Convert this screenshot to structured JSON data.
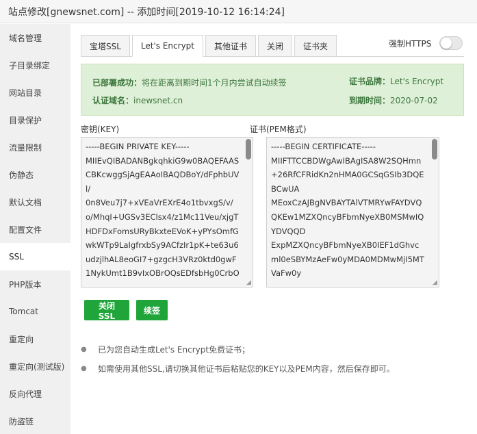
{
  "window": {
    "title": "站点修改[gnewsnet.com] -- 添加时间[2019-10-12 16:14:24]"
  },
  "sidebar": {
    "items": [
      {
        "label": "域名管理"
      },
      {
        "label": "子目录绑定"
      },
      {
        "label": "网站目录"
      },
      {
        "label": "目录保护"
      },
      {
        "label": "流量限制"
      },
      {
        "label": "伪静态"
      },
      {
        "label": "默认文档"
      },
      {
        "label": "配置文件"
      },
      {
        "label": "SSL"
      },
      {
        "label": "PHP版本"
      },
      {
        "label": "Tomcat"
      },
      {
        "label": "重定向"
      },
      {
        "label": "重定向(测试版)"
      },
      {
        "label": "反向代理"
      },
      {
        "label": "防盗链"
      }
    ],
    "active": "SSL"
  },
  "tabs": [
    {
      "label": "宝塔SSL"
    },
    {
      "label": "Let's Encrypt"
    },
    {
      "label": "其他证书"
    },
    {
      "label": "关闭"
    },
    {
      "label": "证书夹"
    }
  ],
  "active_tab": "Let's Encrypt",
  "force_https": {
    "label": "强制HTTPS",
    "enabled": false
  },
  "status": {
    "deployed_label": "已部署成功：",
    "deployed_text": "将在距离到期时间1个月内尝试自动续签",
    "domain_label": "认证域名：",
    "domain_value": "inewsnet.cn",
    "brand_label": "证书品牌：",
    "brand_value": "Let's Encrypt",
    "expiry_label": "到期时间：",
    "expiry_value": "2020-07-02"
  },
  "key_field": {
    "label": "密钥(KEY)",
    "value": "-----BEGIN PRIVATE KEY-----\nMIIEvQIBADANBgkqhkiG9w0BAQEFAASCBKcwggSjAgEAAoIBAQDBoY/dFphbUVl/\n0n8Veu7j7+xVEaVrEXrE4o1tbvxgS/v/o/MhqI+UGSv3EClsx4/z1Mc11Veu/xjgTHDFDxFomsURyBkxteEVoK+yPYsOmfGwkWTp9LaIgfrxbSy9ACfzIr1pK+te63u6udzjlhAL8eoGI7+gzgcH3VRz0ktd0gwF1NykUmt1B9vIxOBrOQsEDfsbHg0CrbO"
  },
  "cert_field": {
    "label": "证书(PEM格式)",
    "value": "-----BEGIN CERTIFICATE-----\nMIIFTTCCBDWgAwIBAgISA8W2SQHmn+26RfCFRidKn2nHMA0GCSqGSIb3DQEBCwUA\nMEoxCzAJBgNVBAYTAlVTMRYwFAYDVQQKEw1MZXQncyBFbmNyeXB0MSMwIQYDVQQD\nExpMZXQncyBFbmNyeXB0IEF1dGhvcml0eSBYMzAeFw0yMDA0MDMwMjI5MTVaFw0y"
  },
  "buttons": {
    "close_ssl": "关闭SSL",
    "renew": "续签"
  },
  "colors": {
    "accent": "#20a53a",
    "status_bg": "#dff0d8",
    "status_text": "#3c763d"
  },
  "notes": [
    "已为您自动生成Let's Encrypt免费证书；",
    "如需使用其他SSL,请切换其他证书后粘贴您的KEY以及PEM内容，然后保存即可。"
  ]
}
